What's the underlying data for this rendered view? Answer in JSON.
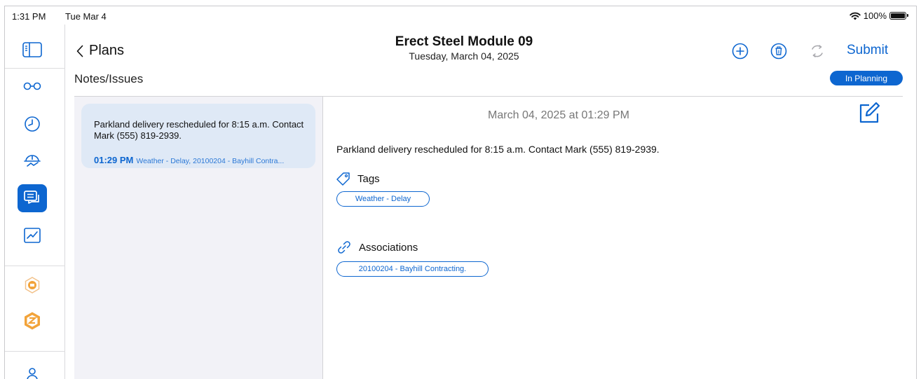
{
  "status_bar": {
    "time": "1:31 PM",
    "date": "Tue Mar 4",
    "battery": "100%"
  },
  "rail": {
    "items": [
      {
        "icon": "sidebar-toggle-icon"
      },
      {
        "icon": "glasses-icon"
      },
      {
        "icon": "clock-icon"
      },
      {
        "icon": "hardhat-icon"
      },
      {
        "icon": "chat-icon",
        "active": true
      },
      {
        "icon": "chart-icon"
      },
      {
        "icon": "orange-badge-icon"
      },
      {
        "icon": "logo-hex-icon"
      }
    ]
  },
  "header": {
    "back_label": "Plans",
    "title": "Erect Steel Module 09",
    "subtitle": "Tuesday, March 04, 2025",
    "submit_label": "Submit"
  },
  "section": {
    "title": "Notes/Issues",
    "status_badge": "In Planning"
  },
  "notes": [
    {
      "text": "Parkland delivery rescheduled for 8:15 a.m. Contact Mark (555) 819-2939.",
      "time": "01:29 PM",
      "meta": "Weather - Delay, 20100204 - Bayhill Contra..."
    }
  ],
  "detail": {
    "timestamp": "March 04, 2025 at 01:29 PM",
    "body": "Parkland delivery rescheduled for 8:15 a.m. Contact Mark (555) 819-2939.",
    "tags_label": "Tags",
    "tags": [
      "Weather - Delay"
    ],
    "associations_label": "Associations",
    "associations": [
      "20100204 - Bayhill Contracting."
    ]
  },
  "colors": {
    "accent": "#0d66d0",
    "list_bg": "#f2f2f7",
    "card_bg": "#dfe9f6",
    "orange": "#f2a33a"
  }
}
